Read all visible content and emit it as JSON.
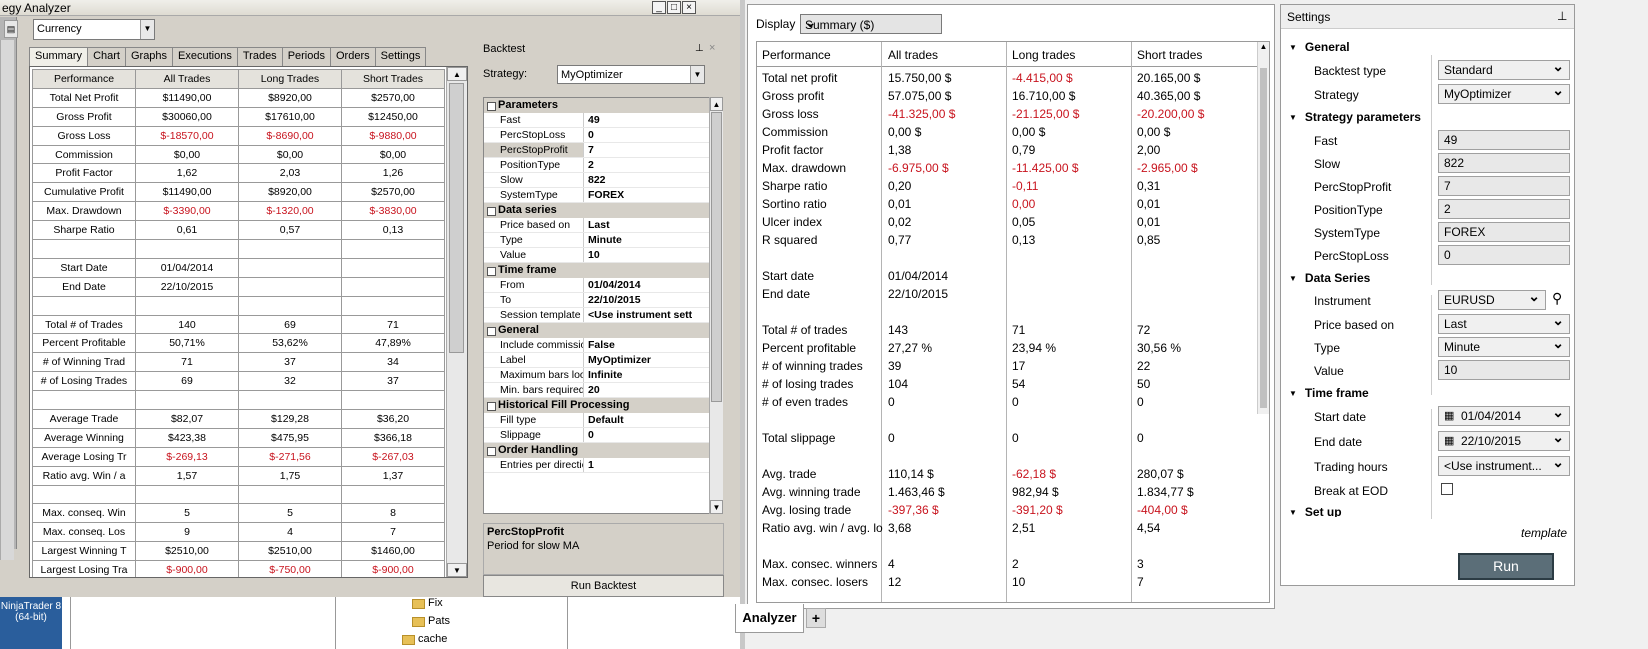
{
  "old_window": {
    "title": "egy Analyzer",
    "currency_value": "Currency",
    "tabs": [
      "Summary",
      "Chart",
      "Graphs",
      "Executions",
      "Trades",
      "Periods",
      "Orders",
      "Settings"
    ],
    "grid": {
      "headers": [
        "Performance",
        "All Trades",
        "Long Trades",
        "Short Trades"
      ],
      "rows": [
        {
          "c": [
            "Total Net Profit",
            "$11490,00",
            "$8920,00",
            "$2570,00"
          ],
          "r": [
            0,
            0,
            0,
            0
          ]
        },
        {
          "c": [
            "Gross Profit",
            "$30060,00",
            "$17610,00",
            "$12450,00"
          ],
          "r": [
            0,
            0,
            0,
            0
          ]
        },
        {
          "c": [
            "Gross Loss",
            "$-18570,00",
            "$-8690,00",
            "$-9880,00"
          ],
          "r": [
            0,
            1,
            1,
            1
          ]
        },
        {
          "c": [
            "Commission",
            "$0,00",
            "$0,00",
            "$0,00"
          ],
          "r": [
            0,
            0,
            0,
            0
          ]
        },
        {
          "c": [
            "Profit Factor",
            "1,62",
            "2,03",
            "1,26"
          ],
          "r": [
            0,
            0,
            0,
            0
          ]
        },
        {
          "c": [
            "Cumulative Profit",
            "$11490,00",
            "$8920,00",
            "$2570,00"
          ],
          "r": [
            0,
            0,
            0,
            0
          ]
        },
        {
          "c": [
            "Max. Drawdown",
            "$-3390,00",
            "$-1320,00",
            "$-3830,00"
          ],
          "r": [
            0,
            1,
            1,
            1
          ]
        },
        {
          "c": [
            "Sharpe Ratio",
            "0,61",
            "0,57",
            "0,13"
          ],
          "r": [
            0,
            0,
            0,
            0
          ]
        },
        {
          "c": [
            "",
            "",
            "",
            ""
          ],
          "r": [
            0,
            0,
            0,
            0
          ]
        },
        {
          "c": [
            "Start Date",
            "01/04/2014",
            "",
            ""
          ],
          "r": [
            0,
            0,
            0,
            0
          ]
        },
        {
          "c": [
            "End Date",
            "22/10/2015",
            "",
            ""
          ],
          "r": [
            0,
            0,
            0,
            0
          ]
        },
        {
          "c": [
            "",
            "",
            "",
            ""
          ],
          "r": [
            0,
            0,
            0,
            0
          ]
        },
        {
          "c": [
            "Total # of Trades",
            "140",
            "69",
            "71"
          ],
          "r": [
            0,
            0,
            0,
            0
          ]
        },
        {
          "c": [
            "Percent Profitable",
            "50,71%",
            "53,62%",
            "47,89%"
          ],
          "r": [
            0,
            0,
            0,
            0
          ]
        },
        {
          "c": [
            "# of Winning Trad",
            "71",
            "37",
            "34"
          ],
          "r": [
            0,
            0,
            0,
            0
          ]
        },
        {
          "c": [
            "# of Losing Trades",
            "69",
            "32",
            "37"
          ],
          "r": [
            0,
            0,
            0,
            0
          ]
        },
        {
          "c": [
            "",
            "",
            "",
            ""
          ],
          "r": [
            0,
            0,
            0,
            0
          ]
        },
        {
          "c": [
            "Average Trade",
            "$82,07",
            "$129,28",
            "$36,20"
          ],
          "r": [
            0,
            0,
            0,
            0
          ]
        },
        {
          "c": [
            "Average Winning",
            "$423,38",
            "$475,95",
            "$366,18"
          ],
          "r": [
            0,
            0,
            0,
            0
          ]
        },
        {
          "c": [
            "Average Losing Tr",
            "$-269,13",
            "$-271,56",
            "$-267,03"
          ],
          "r": [
            0,
            1,
            1,
            1
          ]
        },
        {
          "c": [
            "Ratio avg. Win / a",
            "1,57",
            "1,75",
            "1,37"
          ],
          "r": [
            0,
            0,
            0,
            0
          ]
        },
        {
          "c": [
            "",
            "",
            "",
            ""
          ],
          "r": [
            0,
            0,
            0,
            0
          ]
        },
        {
          "c": [
            "Max. conseq. Win",
            "5",
            "5",
            "8"
          ],
          "r": [
            0,
            0,
            0,
            0
          ]
        },
        {
          "c": [
            "Max. conseq. Los",
            "9",
            "4",
            "7"
          ],
          "r": [
            0,
            0,
            0,
            0
          ]
        },
        {
          "c": [
            "Largest Winning T",
            "$2510,00",
            "$2510,00",
            "$1460,00"
          ],
          "r": [
            0,
            0,
            0,
            0
          ]
        },
        {
          "c": [
            "Largest Losing Tra",
            "$-900,00",
            "$-750,00",
            "$-900,00"
          ],
          "r": [
            0,
            1,
            1,
            1
          ]
        }
      ]
    },
    "backtest": {
      "title": "Backtest",
      "strategy_label": "Strategy:",
      "strategy_value": "MyOptimizer",
      "sections": [
        {
          "name": "Parameters",
          "rows": [
            [
              "Fast",
              "49"
            ],
            [
              "PercStopLoss",
              "0"
            ],
            [
              "PercStopProfit",
              "7"
            ],
            [
              "PositionType",
              "2"
            ],
            [
              "Slow",
              "822"
            ],
            [
              "SystemType",
              "FOREX"
            ]
          ]
        },
        {
          "name": "Data series",
          "rows": [
            [
              "Price based on",
              "Last"
            ],
            [
              "Type",
              "Minute"
            ],
            [
              "Value",
              "10"
            ]
          ]
        },
        {
          "name": "Time frame",
          "rows": [
            [
              "From",
              "01/04/2014"
            ],
            [
              "To",
              "22/10/2015"
            ],
            [
              "Session template",
              "<Use instrument sett"
            ]
          ]
        },
        {
          "name": "General",
          "rows": [
            [
              "Include commission",
              "False"
            ],
            [
              "Label",
              "MyOptimizer"
            ],
            [
              "Maximum bars look b",
              "Infinite"
            ],
            [
              "Min. bars required",
              "20"
            ]
          ]
        },
        {
          "name": "Historical Fill Processing",
          "rows": [
            [
              "Fill type",
              "Default"
            ],
            [
              "Slippage",
              "0"
            ]
          ]
        },
        {
          "name": "Order Handling",
          "rows": [
            [
              "Entries per direction",
              "1"
            ]
          ]
        }
      ],
      "desc_title": "PercStopProfit",
      "desc_text": "Period for slow MA",
      "run_label": "Run Backtest"
    },
    "taskbar": {
      "app": "NinjaTrader 8",
      "bits": "(64-bit)"
    },
    "folders": [
      "Fix",
      "Pats",
      "cache"
    ]
  },
  "new_window": {
    "display_label": "Display",
    "display_value": "Summary ($)",
    "headers": [
      "Performance",
      "All trades",
      "Long trades",
      "Short trades"
    ],
    "rows": [
      {
        "c": [
          "Total net profit",
          "15.750,00 $",
          "-4.415,00 $",
          "20.165,00 $"
        ],
        "r": [
          0,
          0,
          1,
          0
        ]
      },
      {
        "c": [
          "Gross profit",
          "57.075,00 $",
          "16.710,00 $",
          "40.365,00 $"
        ],
        "r": [
          0,
          0,
          0,
          0
        ]
      },
      {
        "c": [
          "Gross loss",
          "-41.325,00 $",
          "-21.125,00 $",
          "-20.200,00 $"
        ],
        "r": [
          0,
          1,
          1,
          1
        ]
      },
      {
        "c": [
          "Commission",
          "0,00 $",
          "0,00 $",
          "0,00 $"
        ],
        "r": [
          0,
          0,
          0,
          0
        ]
      },
      {
        "c": [
          "Profit factor",
          "1,38",
          "0,79",
          "2,00"
        ],
        "r": [
          0,
          0,
          0,
          0
        ]
      },
      {
        "c": [
          "Max. drawdown",
          "-6.975,00 $",
          "-11.425,00 $",
          "-2.965,00 $"
        ],
        "r": [
          0,
          1,
          1,
          1
        ]
      },
      {
        "c": [
          "Sharpe ratio",
          "0,20",
          "-0,11",
          "0,31"
        ],
        "r": [
          0,
          0,
          1,
          0
        ]
      },
      {
        "c": [
          "Sortino ratio",
          "0,01",
          "0,00",
          "0,01"
        ],
        "r": [
          0,
          0,
          1,
          0
        ]
      },
      {
        "c": [
          "Ulcer index",
          "0,02",
          "0,05",
          "0,01"
        ],
        "r": [
          0,
          0,
          0,
          0
        ]
      },
      {
        "c": [
          "R squared",
          "0,77",
          "0,13",
          "0,85"
        ],
        "r": [
          0,
          0,
          0,
          0
        ]
      },
      {
        "c": [
          "",
          "",
          "",
          ""
        ],
        "r": [
          0,
          0,
          0,
          0
        ]
      },
      {
        "c": [
          "Start date",
          "01/04/2014",
          "",
          ""
        ],
        "r": [
          0,
          0,
          0,
          0
        ]
      },
      {
        "c": [
          "End date",
          "22/10/2015",
          "",
          ""
        ],
        "r": [
          0,
          0,
          0,
          0
        ]
      },
      {
        "c": [
          "",
          "",
          "",
          ""
        ],
        "r": [
          0,
          0,
          0,
          0
        ]
      },
      {
        "c": [
          "Total # of trades",
          "143",
          "71",
          "72"
        ],
        "r": [
          0,
          0,
          0,
          0
        ]
      },
      {
        "c": [
          "Percent profitable",
          "27,27 %",
          "23,94 %",
          "30,56 %"
        ],
        "r": [
          0,
          0,
          0,
          0
        ]
      },
      {
        "c": [
          "# of winning trades",
          "39",
          "17",
          "22"
        ],
        "r": [
          0,
          0,
          0,
          0
        ]
      },
      {
        "c": [
          "# of losing trades",
          "104",
          "54",
          "50"
        ],
        "r": [
          0,
          0,
          0,
          0
        ]
      },
      {
        "c": [
          "# of even trades",
          "0",
          "0",
          "0"
        ],
        "r": [
          0,
          0,
          0,
          0
        ]
      },
      {
        "c": [
          "",
          "",
          "",
          ""
        ],
        "r": [
          0,
          0,
          0,
          0
        ]
      },
      {
        "c": [
          "Total slippage",
          "0",
          "0",
          "0"
        ],
        "r": [
          0,
          0,
          0,
          0
        ]
      },
      {
        "c": [
          "",
          "",
          "",
          ""
        ],
        "r": [
          0,
          0,
          0,
          0
        ]
      },
      {
        "c": [
          "Avg. trade",
          "110,14 $",
          "-62,18 $",
          "280,07 $"
        ],
        "r": [
          0,
          0,
          1,
          0
        ]
      },
      {
        "c": [
          "Avg. winning trade",
          "1.463,46 $",
          "982,94 $",
          "1.834,77 $"
        ],
        "r": [
          0,
          0,
          0,
          0
        ]
      },
      {
        "c": [
          "Avg. losing trade",
          "-397,36 $",
          "-391,20 $",
          "-404,00 $"
        ],
        "r": [
          0,
          1,
          1,
          1
        ]
      },
      {
        "c": [
          "Ratio avg. win / avg. lo",
          "3,68",
          "2,51",
          "4,54"
        ],
        "r": [
          0,
          0,
          0,
          0
        ]
      },
      {
        "c": [
          "",
          "",
          "",
          ""
        ],
        "r": [
          0,
          0,
          0,
          0
        ]
      },
      {
        "c": [
          "Max. consec. winners",
          "4",
          "2",
          "3"
        ],
        "r": [
          0,
          0,
          0,
          0
        ]
      },
      {
        "c": [
          "Max. consec. losers",
          "12",
          "10",
          "7"
        ],
        "r": [
          0,
          0,
          0,
          0
        ]
      }
    ],
    "settings": {
      "title": "Settings",
      "groups": {
        "general": "General",
        "strategy_parameters": "Strategy parameters",
        "data_series": "Data Series",
        "time_frame": "Time frame",
        "set_up": "Set up"
      },
      "backtest_type_label": "Backtest type",
      "backtest_type_value": "Standard",
      "strategy_label": "Strategy",
      "strategy_value": "MyOptimizer",
      "fast_label": "Fast",
      "fast_value": "49",
      "slow_label": "Slow",
      "slow_value": "822",
      "percstopprofit_label": "PercStopProfit",
      "percstopprofit_value": "7",
      "positiontype_label": "PositionType",
      "positiontype_value": "2",
      "systemtype_label": "SystemType",
      "systemtype_value": "FOREX",
      "percstoploss_label": "PercStopLoss",
      "percstoploss_value": "0",
      "instrument_label": "Instrument",
      "instrument_value": "EURUSD",
      "price_based_label": "Price based on",
      "price_based_value": "Last",
      "type_label": "Type",
      "type_value": "Minute",
      "value_label": "Value",
      "value_value": "10",
      "start_date_label": "Start date",
      "start_date_value": "01/04/2014",
      "end_date_label": "End date",
      "end_date_value": "22/10/2015",
      "trading_hours_label": "Trading hours",
      "trading_hours_value": "<Use instrument...",
      "break_eod_label": "Break at EOD",
      "template_label": "template",
      "run_label": "Run"
    },
    "bottom_tab": "Analyzer",
    "add_tab": "+"
  }
}
